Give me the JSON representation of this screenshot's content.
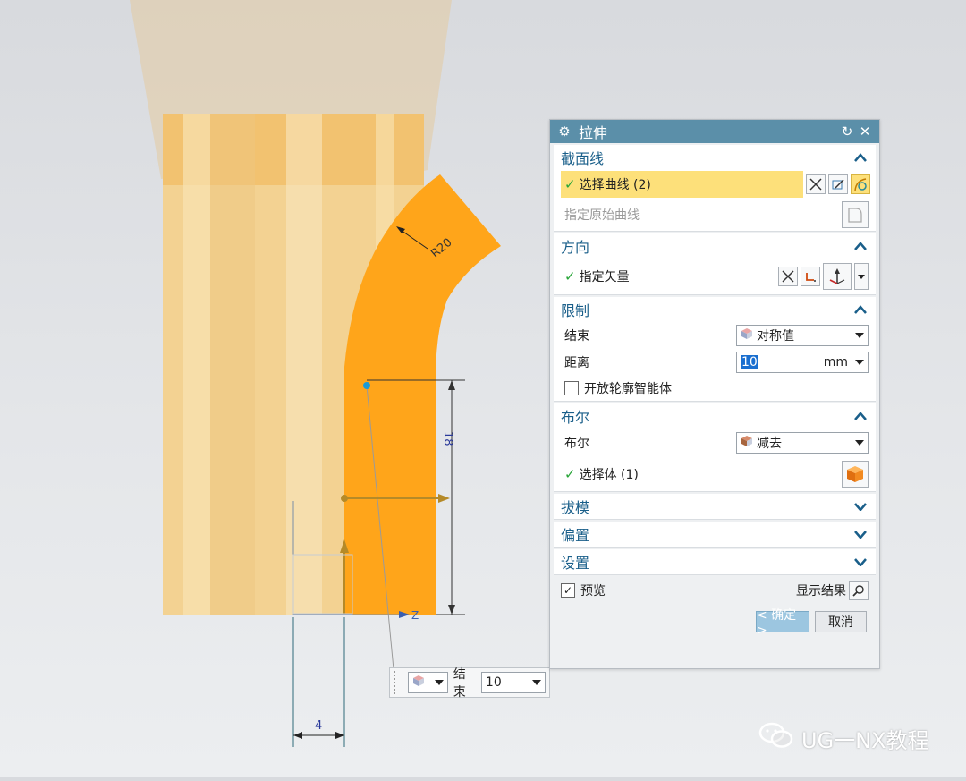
{
  "dialog": {
    "title": "拉伸",
    "section_curve": {
      "header": "截面线",
      "select_curve": "选择曲线 (2)",
      "specify_origin_curve": "指定原始曲线"
    },
    "section_direction": {
      "header": "方向",
      "specify_vector": "指定矢量"
    },
    "section_limits": {
      "header": "限制",
      "end_label": "结束",
      "end_value": "对称值",
      "distance_label": "距离",
      "distance_value": "10",
      "distance_unit": "mm",
      "open_profile": "开放轮廓智能体"
    },
    "section_boolean": {
      "header": "布尔",
      "boolean_label": "布尔",
      "boolean_value": "减去",
      "select_body": "选择体 (1)"
    },
    "section_draft": {
      "header": "拔模"
    },
    "section_offset": {
      "header": "偏置"
    },
    "section_settings": {
      "header": "设置"
    },
    "preview_label": "预览",
    "show_result_label": "显示结果",
    "ok_label": "< 确定 >",
    "cancel_label": "取消"
  },
  "minibar": {
    "end_label": "结束",
    "end_value": "10"
  },
  "dimensions": {
    "radius": "R20",
    "height": "18",
    "width": "4"
  },
  "axis_label": "Z",
  "watermark": "UG一NX教程",
  "colors": {
    "title_bar": "#5b8fa9",
    "highlight": "#fde07a",
    "section_sketch": "#ffa51a",
    "part_body": "#f2cf8e"
  }
}
